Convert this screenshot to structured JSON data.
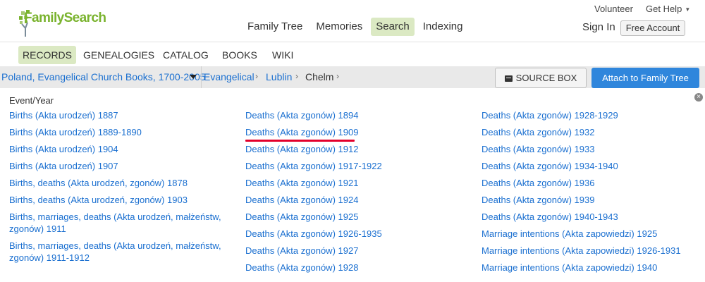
{
  "header": {
    "logo_text": "FamilySearch",
    "top_links": {
      "volunteer": "Volunteer",
      "get_help": "Get Help"
    },
    "nav": [
      "Family Tree",
      "Memories",
      "Search",
      "Indexing"
    ],
    "active_nav": "Search",
    "sign_in": "Sign In",
    "free_account": "Free Account"
  },
  "subnav": {
    "items": [
      "RECORDS",
      "GENEALOGIES",
      "CATALOG",
      "BOOKS",
      "WIKI"
    ],
    "active": "RECORDS"
  },
  "breadcrumb": {
    "collection": "Poland, Evangelical Church Books, 1700-2005",
    "items": [
      "Evangelical",
      "Lublin",
      "Chelm"
    ],
    "separator": "›"
  },
  "actions": {
    "source_box": "SOURCE BOX",
    "attach": "Attach to Family Tree"
  },
  "content": {
    "title": "Event/Year",
    "close": "×",
    "columns": [
      [
        "Births (Akta urodzeń) 1887",
        "Births (Akta urodzeń) 1889-1890",
        "Births (Akta urodzeń) 1904",
        "Births (Akta urodzeń) 1907",
        "Births, deaths (Akta urodzeń, zgonów) 1878",
        "Births, deaths (Akta urodzeń, zgonów) 1903",
        "Births, marriages, deaths (Akta urodzeń, małżeństw, zgonów) 1911",
        "Births, marriages, deaths (Akta urodzeń, małżeństw, zgonów) 1911-1912"
      ],
      [
        "Deaths (Akta zgonów) 1894",
        "Deaths (Akta zgonów) 1909",
        "Deaths (Akta zgonów) 1912",
        "Deaths (Akta zgonów) 1917-1922",
        "Deaths (Akta zgonów) 1921",
        "Deaths (Akta zgonów) 1924",
        "Deaths (Akta zgonów) 1925",
        "Deaths (Akta zgonów) 1926-1935",
        "Deaths (Akta zgonów) 1927",
        "Deaths (Akta zgonów) 1928"
      ],
      [
        "Deaths (Akta zgonów) 1928-1929",
        "Deaths (Akta zgonów) 1932",
        "Deaths (Akta zgonów) 1933",
        "Deaths (Akta zgonów) 1934-1940",
        "Deaths (Akta zgonów) 1936",
        "Deaths (Akta zgonów) 1939",
        "Deaths (Akta zgonów) 1940-1943",
        "Marriage intentions (Akta zapowiedzi) 1925",
        "Marriage intentions (Akta zapowiedzi) 1926-1931",
        "Marriage intentions (Akta zapowiedzi) 1940"
      ]
    ],
    "highlighted": "Deaths (Akta zgonów) 1909"
  },
  "colors": {
    "brand_green": "#7ab32e",
    "active_bg": "#dbe9c3",
    "link": "#1a6fd0",
    "primary_button": "#2f86dc",
    "highlight_underline": "#e3002b"
  }
}
